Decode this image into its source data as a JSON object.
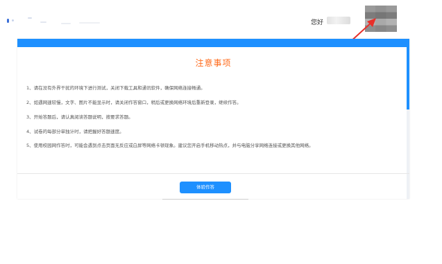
{
  "header": {
    "greeting": "您好"
  },
  "notice": {
    "title": "注意事项",
    "items": [
      "1、请在没有外界干扰的环境下进行测试，关闭下载工具和通讯软件，确保网络连接畅通。",
      "2、如遇网速较慢，文字、图片不能显示时，请关闭作答窗口，稍后或更换网络环境后重新登录，继续作答。",
      "3、开始答题后，请认真阅读答题说明，按要求答题。",
      "4、试卷的每部分单独计时，请把握好答题速度。",
      "5、使用校园网作答时，可能会遇到点击页面无反应或白屏等网络卡顿现象。建议您开启手机移动热点，并与电脑分享网络连接或更换其他网络。"
    ],
    "start_button": "体验作答"
  },
  "colors": {
    "accent_blue": "#1e90ff",
    "title_orange": "#ff6a1a",
    "arrow_red": "#e8302a"
  }
}
